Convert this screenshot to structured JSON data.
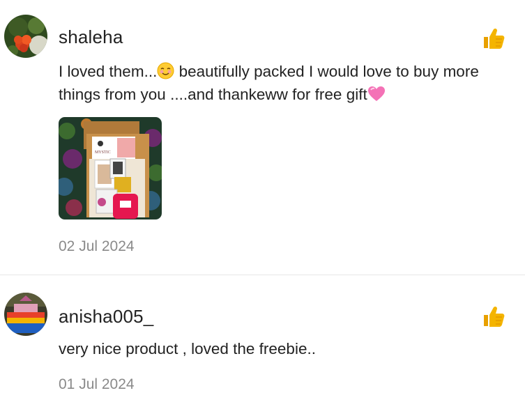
{
  "reviews": [
    {
      "username": "shaleha",
      "text_part1": "I loved them...",
      "text_part2": " beautifully packed I would love to buy more things from you ....and thankeww for free gift",
      "emoji1": "smiling-face-emoji",
      "emoji2": "pink-heart-emoji",
      "photo_label": "MYSTIC",
      "date": "02 Jul 2024",
      "like_icon": "thumbs-up-icon"
    },
    {
      "username": "anisha005_",
      "text_part1": "very nice product , loved the freebie..",
      "date": "01 Jul 2024",
      "like_icon": "thumbs-up-icon"
    }
  ],
  "colors": {
    "thumb": "#F4B400",
    "date": "#8a8a8a",
    "divider": "#e6e6e6"
  }
}
